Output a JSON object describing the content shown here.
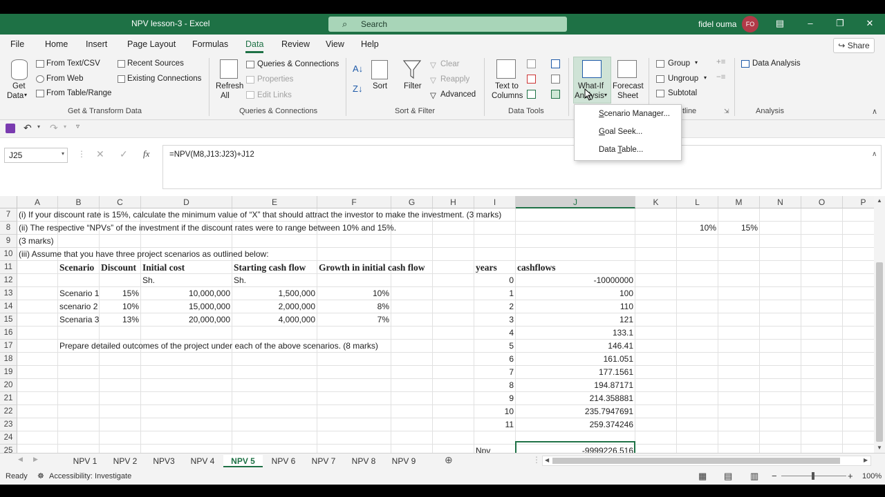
{
  "window": {
    "title": "NPV lesson-3  -  Excel",
    "user": "fidel ouma",
    "avatar_initials": "FO"
  },
  "search": {
    "placeholder": "Search"
  },
  "ribbon_tabs": [
    "File",
    "Home",
    "Insert",
    "Page Layout",
    "Formulas",
    "Data",
    "Review",
    "View",
    "Help"
  ],
  "active_tab": "Data",
  "share_label": "Share",
  "ribbon": {
    "get_data": "Get\nData",
    "get_data_l1": "Get",
    "get_data_l2": "Data",
    "from_text_csv": "From Text/CSV",
    "from_web": "From Web",
    "from_table_range": "From Table/Range",
    "recent_sources": "Recent Sources",
    "existing_connections": "Existing Connections",
    "group_get_transform": "Get & Transform Data",
    "refresh_l1": "Refresh",
    "refresh_l2": "All",
    "queries_connections": "Queries & Connections",
    "properties": "Properties",
    "edit_links": "Edit Links",
    "group_queries": "Queries & Connections",
    "sort": "Sort",
    "filter": "Filter",
    "clear": "Clear",
    "reapply": "Reapply",
    "advanced": "Advanced",
    "group_sort_filter": "Sort & Filter",
    "text_to_columns_l1": "Text to",
    "text_to_columns_l2": "Columns",
    "group_data_tools": "Data Tools",
    "whatif_l1": "What-If",
    "whatif_l2": "Analysis",
    "forecast_l1": "Forecast",
    "forecast_l2": "Sheet",
    "group": "Group",
    "ungroup": "Ungroup",
    "subtotal": "Subtotal",
    "group_outline": "tline",
    "data_analysis": "Data Analysis",
    "group_analysis": "Analysis"
  },
  "whatif_menu": {
    "items": [
      {
        "prefix": "",
        "accel": "S",
        "rest": "cenario Manager..."
      },
      {
        "prefix": "",
        "accel": "G",
        "rest": "oal Seek..."
      },
      {
        "prefix": "Data ",
        "accel": "T",
        "rest": "able..."
      }
    ]
  },
  "formula_bar": {
    "name_box": "J25",
    "fx": "fx",
    "formula": "=NPV(M8,J13:J23)+J12"
  },
  "columns": [
    "A",
    "B",
    "C",
    "D",
    "E",
    "F",
    "G",
    "H",
    "I",
    "J",
    "K",
    "L",
    "M",
    "N",
    "O",
    "P"
  ],
  "rows": [
    "7",
    "8",
    "9",
    "10",
    "11",
    "12",
    "13",
    "14",
    "15",
    "16",
    "17",
    "18",
    "19",
    "20",
    "21",
    "22",
    "23",
    "24",
    "25"
  ],
  "cells": {
    "A7": "(i) If your discount rate is 15%, calculate the minimum value of “X” that should attract the investor to make the investment. (3 marks)",
    "A8": "(ii) The respective “NPVs” of the investment if the discount rates were to range between 10% and 15%.",
    "L8": "10%",
    "M8": "15%",
    "A9": "(3 marks)",
    "A10": "(iii) Assume that you have three project scenarios as outlined below:",
    "B11": "Scenario",
    "C11": "Discount",
    "D11": "Initial cost",
    "E11": "Starting cash flow",
    "F11": "Growth in initial cash flow",
    "I11": "years",
    "J11": "cashflows",
    "D12": "Sh.",
    "E12": "Sh.",
    "I12": "0",
    "J12": "-10000000",
    "B13": "Scenario 1",
    "C13": "15%",
    "D13": "10,000,000",
    "E13": "1,500,000",
    "F13": "10%",
    "I13": "1",
    "J13": "100",
    "B14": "scenario 2",
    "C14": "10%",
    "D14": "15,000,000",
    "E14": "2,000,000",
    "F14": "8%",
    "I14": "2",
    "J14": "110",
    "B15": "Scenaria 3",
    "C15": "13%",
    "D15": "20,000,000",
    "E15": "4,000,000",
    "F15": "7%",
    "I15": "3",
    "J15": "121",
    "I16": "4",
    "J16": "133.1",
    "B17": "Prepare detailed outcomes of the project under each of the above scenarios. (8 marks)",
    "I17": "5",
    "J17": "146.41",
    "I18": "6",
    "J18": "161.051",
    "I19": "7",
    "J19": "177.1561",
    "I20": "8",
    "J20": "194.87171",
    "I21": "9",
    "J21": "214.358881",
    "I22": "10",
    "J22": "235.7947691",
    "I23": "11",
    "J23": "259.374246",
    "I25": "Npv",
    "J25": "-9999226.516"
  },
  "sheet_tabs": [
    "NPV 1",
    "NPV 2",
    "NPV3",
    "NPV 4",
    "NPV 5",
    "NPV 6",
    "NPV 7",
    "NPV 8",
    "NPV 9"
  ],
  "active_sheet": "NPV 5",
  "status": {
    "ready": "Ready",
    "accessibility": "Accessibility: Investigate",
    "zoom": "100%"
  },
  "colors": {
    "accent": "#1e7145",
    "search_bg": "#a8d5b8",
    "avatar": "#b23a48"
  }
}
